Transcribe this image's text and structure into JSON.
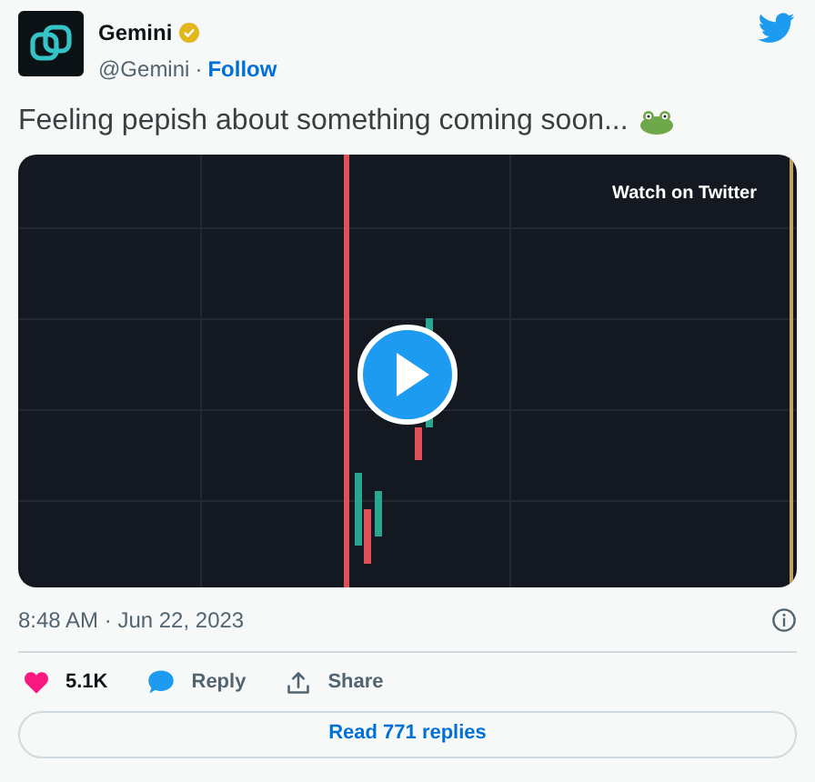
{
  "author": {
    "name": "Gemini",
    "handle": "@Gemini",
    "separator": "·",
    "follow": "Follow",
    "verified": true
  },
  "text": "Feeling pepish about something coming soon...",
  "media": {
    "kind": "picture",
    "overlay": "Watch on Twitter"
  },
  "timestamp": "8:48 AM · Jun 22, 2023",
  "actions": [
    {
      "kind": "like",
      "label": "5.1K"
    },
    {
      "kind": "reply",
      "label": "Reply"
    },
    {
      "kind": "share",
      "label": "Share"
    }
  ],
  "read_replies": "Read 771 replies"
}
